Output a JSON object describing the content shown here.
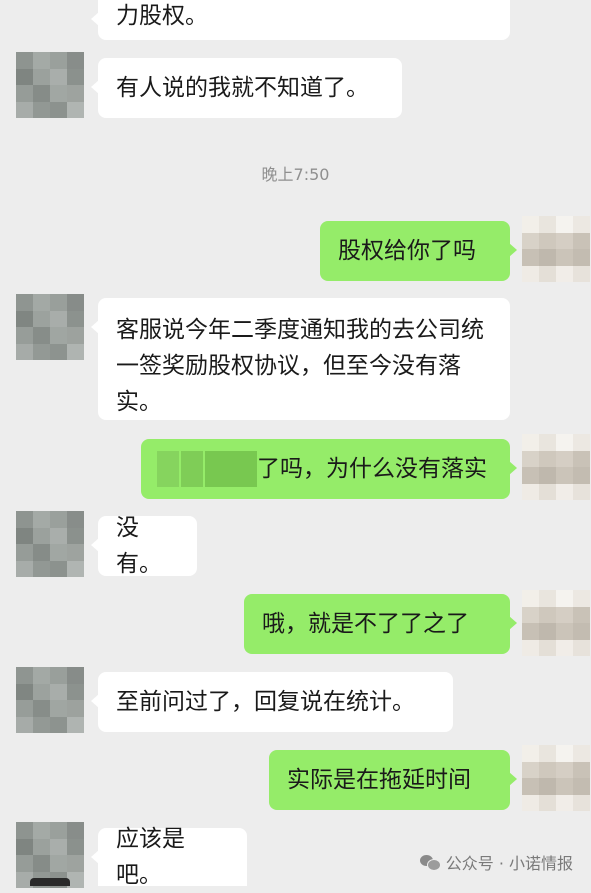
{
  "chat": {
    "timestamp": "晚上7:50",
    "messages": [
      {
        "side": "in",
        "text": "力股权。"
      },
      {
        "side": "in",
        "text": "有人说的我就不知道了。"
      },
      {
        "side": "out",
        "text": "股权给你了吗"
      },
      {
        "side": "in",
        "text": "客服说今年二季度通知我的去公司统一签奖励股权协议，但至今没有落实。"
      },
      {
        "side": "out",
        "text": "了吗，为什么没有落实"
      },
      {
        "side": "in",
        "text": "没有。"
      },
      {
        "side": "out",
        "text": "哦，就是不了了之了"
      },
      {
        "side": "in",
        "text": "至前问过了，回复说在统计。"
      },
      {
        "side": "out",
        "text": "实际是在拖延时间"
      },
      {
        "side": "in",
        "text": "应该是吧。"
      }
    ]
  },
  "watermark": {
    "text": "公众号 · 小诺情报",
    "icon": "wechat-icon"
  },
  "colors": {
    "background": "#ededed",
    "incoming_bubble": "#ffffff",
    "outgoing_bubble": "#95ec69",
    "timestamp_text": "#8f8f8f"
  }
}
